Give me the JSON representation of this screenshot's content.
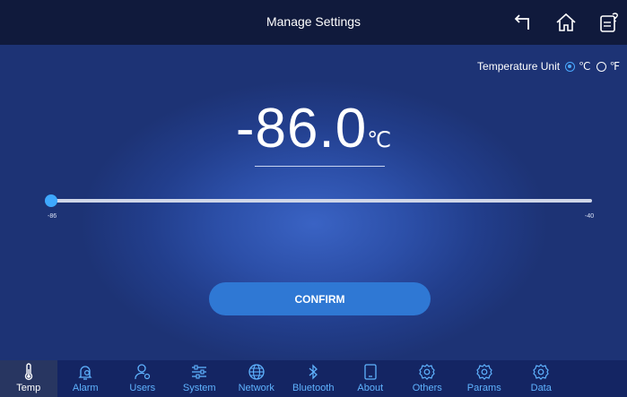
{
  "header": {
    "title": "Manage Settings",
    "icons": [
      "back-icon",
      "home-icon",
      "help-icon"
    ]
  },
  "unit": {
    "label": "Temperature Unit",
    "options": [
      "℃",
      "℉"
    ],
    "selected": "℃"
  },
  "setpoint": {
    "value": "-86.0",
    "unit": "℃"
  },
  "slider": {
    "min_label": "-86",
    "max_label": "-40",
    "value": -86
  },
  "confirm_label": "CONFIRM",
  "nav": {
    "items": [
      {
        "label": "Temp",
        "icon": "thermometer-icon"
      },
      {
        "label": "Alarm",
        "icon": "alarm-gear-icon"
      },
      {
        "label": "Users",
        "icon": "user-gear-icon"
      },
      {
        "label": "System",
        "icon": "sliders-icon"
      },
      {
        "label": "Network",
        "icon": "globe-icon"
      },
      {
        "label": "Bluetooth",
        "icon": "bluetooth-icon"
      },
      {
        "label": "About",
        "icon": "tablet-icon"
      },
      {
        "label": "Others",
        "icon": "gear-icon"
      },
      {
        "label": "Params",
        "icon": "gear-icon"
      },
      {
        "label": "Data",
        "icon": "gear-icon"
      }
    ],
    "active": "Temp"
  },
  "colors": {
    "accent": "#3ea8ff",
    "topbar": "#101a3c",
    "navbar": "#142563",
    "confirm": "#2f78d4"
  }
}
